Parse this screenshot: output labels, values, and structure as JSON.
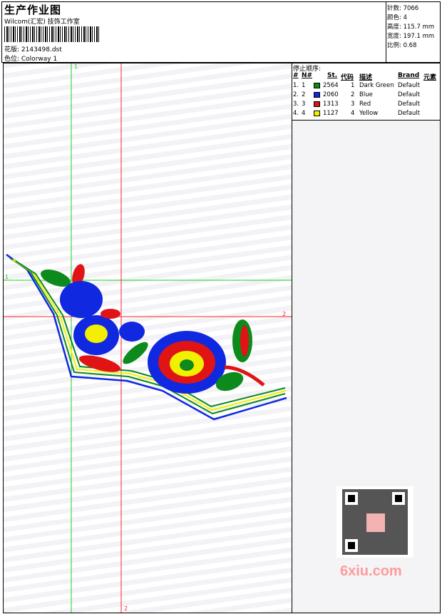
{
  "header": {
    "title": "生产作业图",
    "subtitle": "Wilcom(汇宏) 技饰工作室",
    "design_label": "花版: 2143498.dst",
    "colorway_label": "色位:  Colorway 1"
  },
  "stats": {
    "stitches": "针数: 7066",
    "colors": "颜色: 4",
    "height": "高度: 115.7 mm",
    "width": "宽度: 197.1 mm",
    "ratio": "比例: 0.68"
  },
  "stop_sequence": {
    "title": "停止顺序:",
    "headers": {
      "num": "#",
      "n": "N#",
      "st": "St.",
      "code": "代码",
      "desc": "描述",
      "brand": "Brand",
      "elem": "元素"
    },
    "rows": [
      {
        "num": "1.",
        "n": "1",
        "color": "#0c8a1c",
        "st": "2564",
        "code": "1",
        "desc": "Dark Green",
        "brand": "Default"
      },
      {
        "num": "2.",
        "n": "2",
        "color": "#1028e0",
        "st": "2060",
        "code": "2",
        "desc": "Blue",
        "brand": "Default"
      },
      {
        "num": "3.",
        "n": "3",
        "color": "#e01414",
        "st": "1313",
        "code": "3",
        "desc": "Red",
        "brand": "Default"
      },
      {
        "num": "4.",
        "n": "4",
        "color": "#f2f000",
        "st": "1127",
        "code": "4",
        "desc": "Yellow",
        "brand": "Default"
      }
    ]
  },
  "guides": {
    "v1": "1",
    "h1": "1",
    "h2": "2",
    "v2": "2"
  },
  "watermark": "6xiu.com",
  "colors": {
    "green_guide": "#22cc22",
    "red_guide": "#ff2020"
  }
}
